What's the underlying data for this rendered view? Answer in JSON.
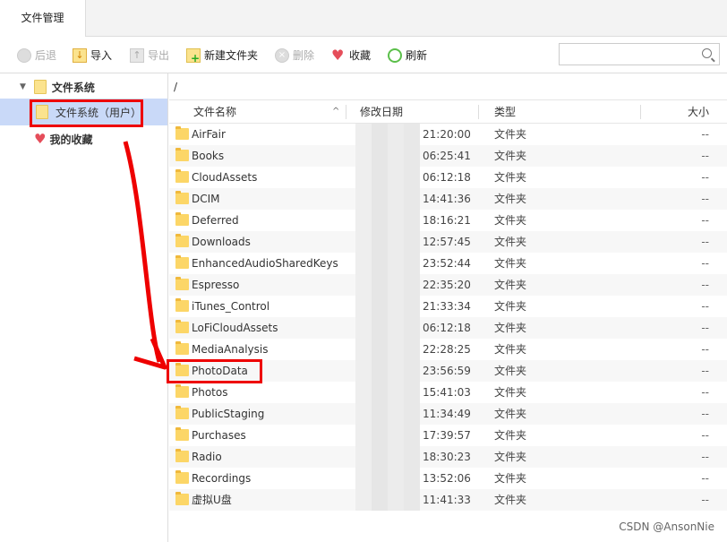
{
  "tab": {
    "label": "文件管理"
  },
  "toolbar": {
    "back": "后退",
    "import": "导入",
    "export": "导出",
    "new_folder": "新建文件夹",
    "delete": "删除",
    "favorite": "收藏",
    "refresh": "刷新"
  },
  "search": {
    "placeholder": "",
    "value": ""
  },
  "sidebar": {
    "root": "文件系统",
    "user": "文件系统（用户）",
    "favorites": "我的收藏"
  },
  "path": "/",
  "columns": {
    "name": "文件名称",
    "date": "修改日期",
    "type": "类型",
    "size": "大小"
  },
  "rows": [
    {
      "name": "AirFair",
      "time": "21:20:00",
      "type": "文件夹",
      "size": "--"
    },
    {
      "name": "Books",
      "time": "06:25:41",
      "type": "文件夹",
      "size": "--"
    },
    {
      "name": "CloudAssets",
      "time": "06:12:18",
      "type": "文件夹",
      "size": "--"
    },
    {
      "name": "DCIM",
      "time": "14:41:36",
      "type": "文件夹",
      "size": "--"
    },
    {
      "name": "Deferred",
      "time": "18:16:21",
      "type": "文件夹",
      "size": "--"
    },
    {
      "name": "Downloads",
      "time": "12:57:45",
      "type": "文件夹",
      "size": "--"
    },
    {
      "name": "EnhancedAudioSharedKeys",
      "time": "23:52:44",
      "type": "文件夹",
      "size": "--"
    },
    {
      "name": "Espresso",
      "time": "22:35:20",
      "type": "文件夹",
      "size": "--"
    },
    {
      "name": "iTunes_Control",
      "time": "21:33:34",
      "type": "文件夹",
      "size": "--"
    },
    {
      "name": "LoFiCloudAssets",
      "time": "06:12:18",
      "type": "文件夹",
      "size": "--"
    },
    {
      "name": "MediaAnalysis",
      "time": "22:28:25",
      "type": "文件夹",
      "size": "--"
    },
    {
      "name": "PhotoData",
      "time": "23:56:59",
      "type": "文件夹",
      "size": "--"
    },
    {
      "name": "Photos",
      "time": "15:41:03",
      "type": "文件夹",
      "size": "--"
    },
    {
      "name": "PublicStaging",
      "time": "11:34:49",
      "type": "文件夹",
      "size": "--"
    },
    {
      "name": "Purchases",
      "time": "17:39:57",
      "type": "文件夹",
      "size": "--"
    },
    {
      "name": "Radio",
      "time": "18:30:23",
      "type": "文件夹",
      "size": "--"
    },
    {
      "name": "Recordings",
      "time": "13:52:06",
      "type": "文件夹",
      "size": "--"
    },
    {
      "name": "虚拟U盘",
      "time": "11:41:33",
      "type": "文件夹",
      "size": "--"
    }
  ],
  "watermark": "CSDN @AnsonNie",
  "colors": {
    "selection": "#c9d9f8",
    "annotation": "#e00000"
  }
}
